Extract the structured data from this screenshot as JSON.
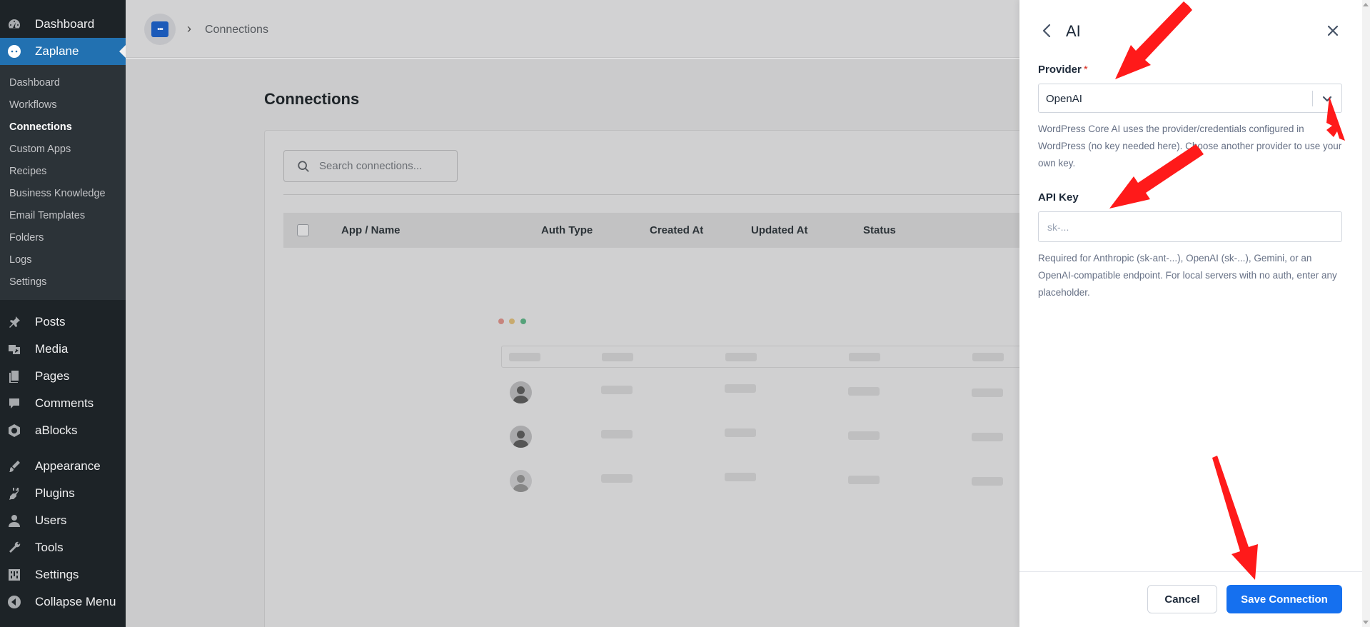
{
  "sidebar": {
    "top_items": [
      {
        "label": "Dashboard",
        "icon": "dashboard-icon"
      }
    ],
    "current": {
      "label": "Zaplane",
      "icon": "zaplane-icon"
    },
    "submenu": [
      "Dashboard",
      "Workflows",
      "Connections",
      "Custom Apps",
      "Recipes",
      "Business Knowledge",
      "Email Templates",
      "Folders",
      "Logs",
      "Settings"
    ],
    "submenu_current": "Connections",
    "group2": [
      {
        "label": "Posts",
        "icon": "pin-icon"
      },
      {
        "label": "Media",
        "icon": "media-icon"
      },
      {
        "label": "Pages",
        "icon": "pages-icon"
      },
      {
        "label": "Comments",
        "icon": "comment-icon"
      },
      {
        "label": "aBlocks",
        "icon": "ablocks-icon"
      }
    ],
    "group3": [
      {
        "label": "Appearance",
        "icon": "brush-icon"
      },
      {
        "label": "Plugins",
        "icon": "plug-icon"
      },
      {
        "label": "Users",
        "icon": "user-icon"
      },
      {
        "label": "Tools",
        "icon": "wrench-icon"
      },
      {
        "label": "Settings",
        "icon": "settings-icon"
      },
      {
        "label": "Collapse Menu",
        "icon": "collapse-icon"
      }
    ]
  },
  "header": {
    "breadcrumb": "Connections"
  },
  "main": {
    "title": "Connections",
    "search_placeholder": "Search connections...",
    "columns": [
      "App / Name",
      "Auth Type",
      "Created At",
      "Updated At",
      "Status"
    ]
  },
  "drawer": {
    "title": "AI",
    "provider_label": "Provider",
    "required_mark": "*",
    "provider_value": "OpenAI",
    "provider_help": "WordPress Core AI uses the provider/credentials configured in WordPress (no key needed here). Choose another provider to use your own key.",
    "api_key_label": "API Key",
    "api_key_placeholder": "sk-...",
    "api_key_help": "Required for Anthropic (sk-ant-...), OpenAI (sk-...), Gemini, or an OpenAI-compatible endpoint. For local servers with no auth, enter any placeholder.",
    "cancel_label": "Cancel",
    "save_label": "Save Connection"
  },
  "colors": {
    "accent": "#1570ef",
    "wp_blue": "#2271b1",
    "annotation": "#ff1a1a"
  }
}
